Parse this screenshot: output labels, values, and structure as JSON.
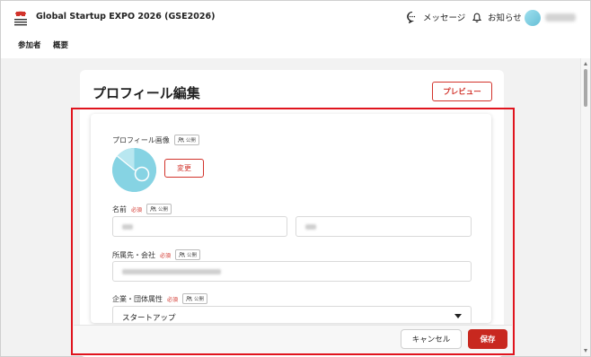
{
  "app": {
    "title": "Global Startup EXPO 2026 (GSE2026)",
    "logo_icon": "gse-logo-icon",
    "accent_color": "#d2332b"
  },
  "header": {
    "messages_label": "メッセージ",
    "messages_icon": "chat-bubble-icon",
    "notifications_label": "お知らせ",
    "notifications_icon": "bell-icon"
  },
  "subnav": {
    "items": [
      {
        "label": "参加者"
      },
      {
        "label": "概要"
      }
    ]
  },
  "page": {
    "title": "プロフィール編集",
    "preview_label": "プレビュー"
  },
  "form": {
    "profile_image": {
      "label": "プロフィール画像",
      "public_badge": "公開",
      "change_label": "変更"
    },
    "name": {
      "label": "名前",
      "required": "必須",
      "public_badge": "公開"
    },
    "affiliation": {
      "label": "所属先・会社",
      "required": "必須",
      "public_badge": "公開"
    },
    "org_type": {
      "label": "企業・団体属性",
      "required": "必須",
      "public_badge": "公開",
      "value": "スタートアップ"
    }
  },
  "footer": {
    "cancel_label": "キャンセル",
    "save_label": "保存"
  }
}
